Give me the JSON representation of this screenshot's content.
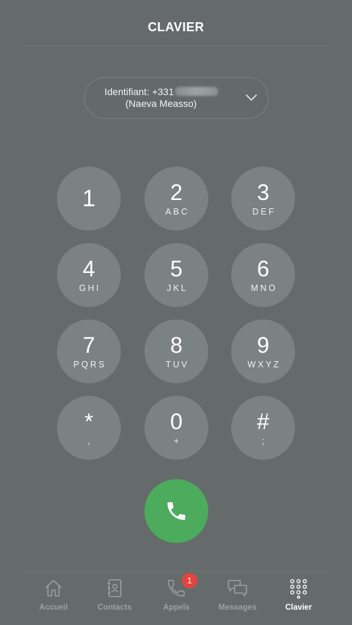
{
  "header": {
    "title": "CLAVIER"
  },
  "identity": {
    "line1": "Identifiant: +331",
    "line2": "(Naeva Measso)"
  },
  "keypad": {
    "keys": [
      {
        "digit": "1",
        "letters": ""
      },
      {
        "digit": "2",
        "letters": "ABC"
      },
      {
        "digit": "3",
        "letters": "DEF"
      },
      {
        "digit": "4",
        "letters": "GHI"
      },
      {
        "digit": "5",
        "letters": "JKL"
      },
      {
        "digit": "6",
        "letters": "MNO"
      },
      {
        "digit": "7",
        "letters": "PQRS"
      },
      {
        "digit": "8",
        "letters": "TUV"
      },
      {
        "digit": "9",
        "letters": "WXYZ"
      },
      {
        "digit": "*",
        "letters": ","
      },
      {
        "digit": "0",
        "letters": "+"
      },
      {
        "digit": "#",
        "letters": ";"
      }
    ]
  },
  "call": {
    "icon": "phone-icon",
    "color": "#4cab5c"
  },
  "tabbar": {
    "tabs": [
      {
        "label": "Accueil",
        "icon": "home-icon"
      },
      {
        "label": "Contacts",
        "icon": "contacts-book-icon"
      },
      {
        "label": "Appels",
        "icon": "phone-outline-icon",
        "badge": "1"
      },
      {
        "label": "Messages",
        "icon": "chat-bubbles-icon"
      },
      {
        "label": "Clavier",
        "icon": "keypad-grid-icon"
      }
    ],
    "active_tab": "Clavier"
  },
  "colors": {
    "background": "#646b6a",
    "key": "#7b8281",
    "call": "#4cab5c",
    "badge": "#e5433f"
  }
}
